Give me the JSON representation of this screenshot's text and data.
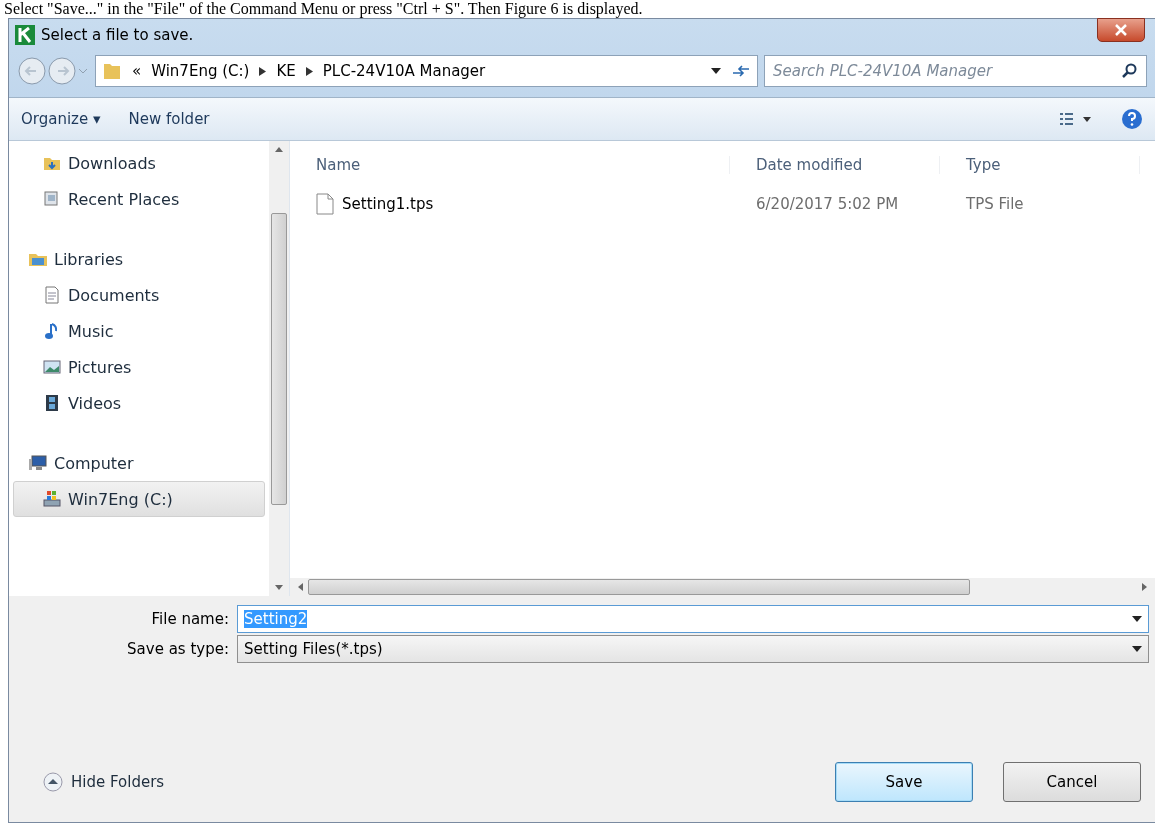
{
  "caption": "Select \"Save...\" in the \"File\" of the Command Menu or press \"Ctrl + S\". Then Figure 6 is displayed.",
  "window": {
    "title": "Select a file to save."
  },
  "address": {
    "crumbs": [
      "«",
      "Win7Eng (C:)",
      "KE",
      "PLC-24V10A Manager"
    ],
    "search_placeholder": "Search PLC-24V10A Manager"
  },
  "toolbar": {
    "organize": "Organize ▾",
    "new_folder": "New folder"
  },
  "nav": [
    {
      "label": "Downloads",
      "kind": "item",
      "selected": false
    },
    {
      "label": "Recent Places",
      "kind": "item",
      "selected": false
    },
    {
      "label": "Libraries",
      "kind": "group",
      "selected": false
    },
    {
      "label": "Documents",
      "kind": "item",
      "selected": false
    },
    {
      "label": "Music",
      "kind": "item",
      "selected": false
    },
    {
      "label": "Pictures",
      "kind": "item",
      "selected": false
    },
    {
      "label": "Videos",
      "kind": "item",
      "selected": false
    },
    {
      "label": "Computer",
      "kind": "group",
      "selected": false
    },
    {
      "label": "Win7Eng (C:)",
      "kind": "item",
      "selected": true
    }
  ],
  "columns": [
    "Name",
    "Date modified",
    "Type"
  ],
  "files": [
    {
      "name": "Setting1.tps",
      "date": "6/20/2017 5:02 PM",
      "type": "TPS File",
      "selected": false
    }
  ],
  "file_name": {
    "label": "File name:",
    "value": "Setting2"
  },
  "save_type": {
    "label": "Save as type:",
    "value": "Setting Files(*.tps)"
  },
  "hide_folders": "Hide Folders",
  "buttons": [
    {
      "label": "Save",
      "kind": "default"
    },
    {
      "label": "Cancel",
      "kind": "normal"
    }
  ]
}
